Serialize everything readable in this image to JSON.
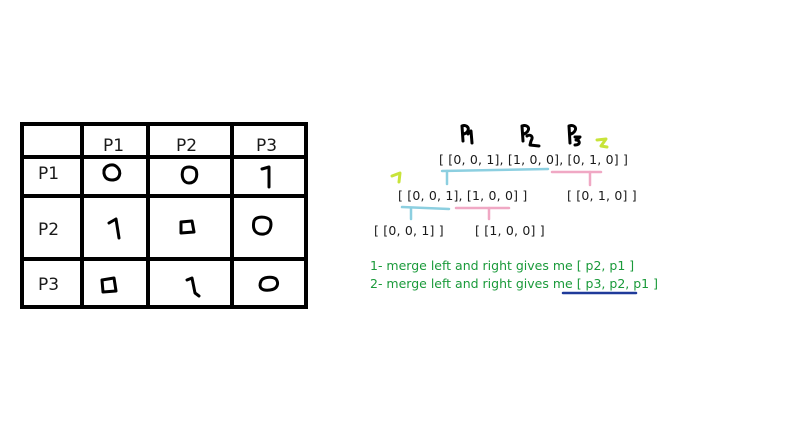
{
  "table": {
    "col_headers": [
      "P1",
      "P2",
      "P3"
    ],
    "rows": [
      {
        "label": "P1",
        "cells": [
          "0",
          "0",
          "1"
        ]
      },
      {
        "label": "P2",
        "cells": [
          "1",
          "0",
          "0"
        ]
      },
      {
        "label": "P3",
        "cells": [
          "0",
          "1",
          "0"
        ]
      }
    ]
  },
  "tree": {
    "handwritten_labels": [
      "P1",
      "P2",
      "P3"
    ],
    "marks": [
      "1",
      "2"
    ],
    "root": "[ [0, 0, 1], [1, 0, 0], [0, 1, 0] ]",
    "level1_left": "[ [0, 0, 1], [1, 0, 0] ]",
    "level1_right": "[ [0, 1, 0] ]",
    "level2_left": "[ [0, 0, 1] ]",
    "level2_right": "[ [1, 0, 0] ]"
  },
  "notes": [
    {
      "text": "1- merge left and right gives me [ p2, p1 ]"
    },
    {
      "text": "2- merge left and right gives me [ p3, p2, p1 ]"
    }
  ],
  "colors": {
    "table_border": "#000000",
    "bracket_blue": "#8ccfe0",
    "bracket_pink": "#f0a8c4",
    "note_text": "#1a9a3a",
    "mark_yellow": "#c8e43a",
    "underline_navy": "#1f3a9a"
  }
}
